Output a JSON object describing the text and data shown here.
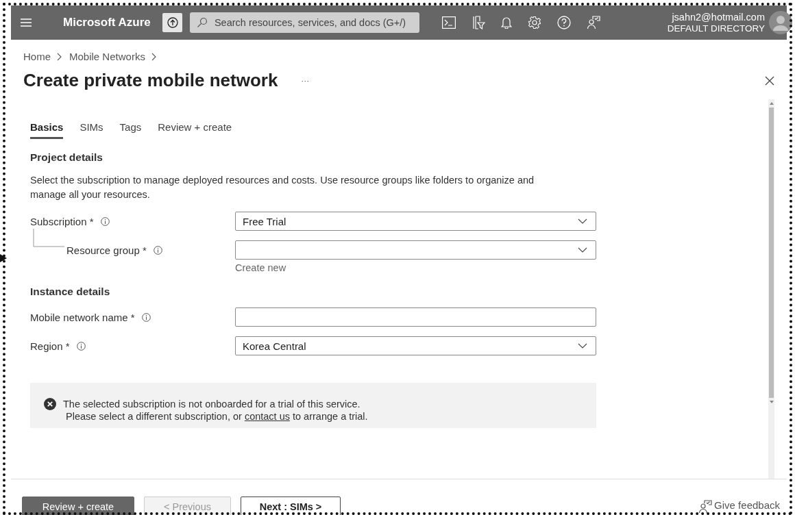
{
  "topbar": {
    "brand": "Microsoft Azure",
    "search": {
      "placeholder": "Search resources, services, and docs (G+/)"
    },
    "user": {
      "email": "jsahn2@hotmail.com",
      "directory": "DEFAULT DIRECTORY"
    }
  },
  "breadcrumb": [
    "Home",
    "Mobile Networks"
  ],
  "title": "Create private mobile network",
  "more": "···",
  "tabs": [
    {
      "label": "Basics",
      "selected": true
    },
    {
      "label": "SIMs",
      "selected": false
    },
    {
      "label": "Tags",
      "selected": false
    },
    {
      "label": "Review + create",
      "selected": false
    }
  ],
  "sections": [
    {
      "heading": "Project details",
      "description": "Select the subscription to manage deployed resources and costs. Use resource groups like folders to organize and manage all your resources.",
      "fields": [
        {
          "label": "Subscription *",
          "kind": "dropdown",
          "value": "Free Trial",
          "nested": false
        },
        {
          "label": "Resource group *",
          "kind": "dropdown",
          "nested": true,
          "link": "Create new"
        }
      ]
    },
    {
      "heading": "Instance details",
      "fields": [
        {
          "label": "Mobile network name *",
          "kind": "text",
          "nested": false
        },
        {
          "label": "Region *",
          "kind": "dropdown",
          "value": "Korea Central",
          "nested": false
        }
      ]
    }
  ],
  "error": {
    "line1": "The selected subscription is not onboarded for a trial of this service.",
    "line2_before": "Please select a different subscription, or",
    "link": "contact us",
    "line2_after": "to arrange a trial."
  },
  "buttons": [
    {
      "label": "Review + create",
      "kind": "primary",
      "disabled": false
    },
    {
      "label": "< Previous",
      "kind": "secondary",
      "disabled": true
    },
    {
      "label": "Next : SIMs >",
      "kind": "secondary",
      "disabled": false
    }
  ],
  "feedback": "Give feedback"
}
